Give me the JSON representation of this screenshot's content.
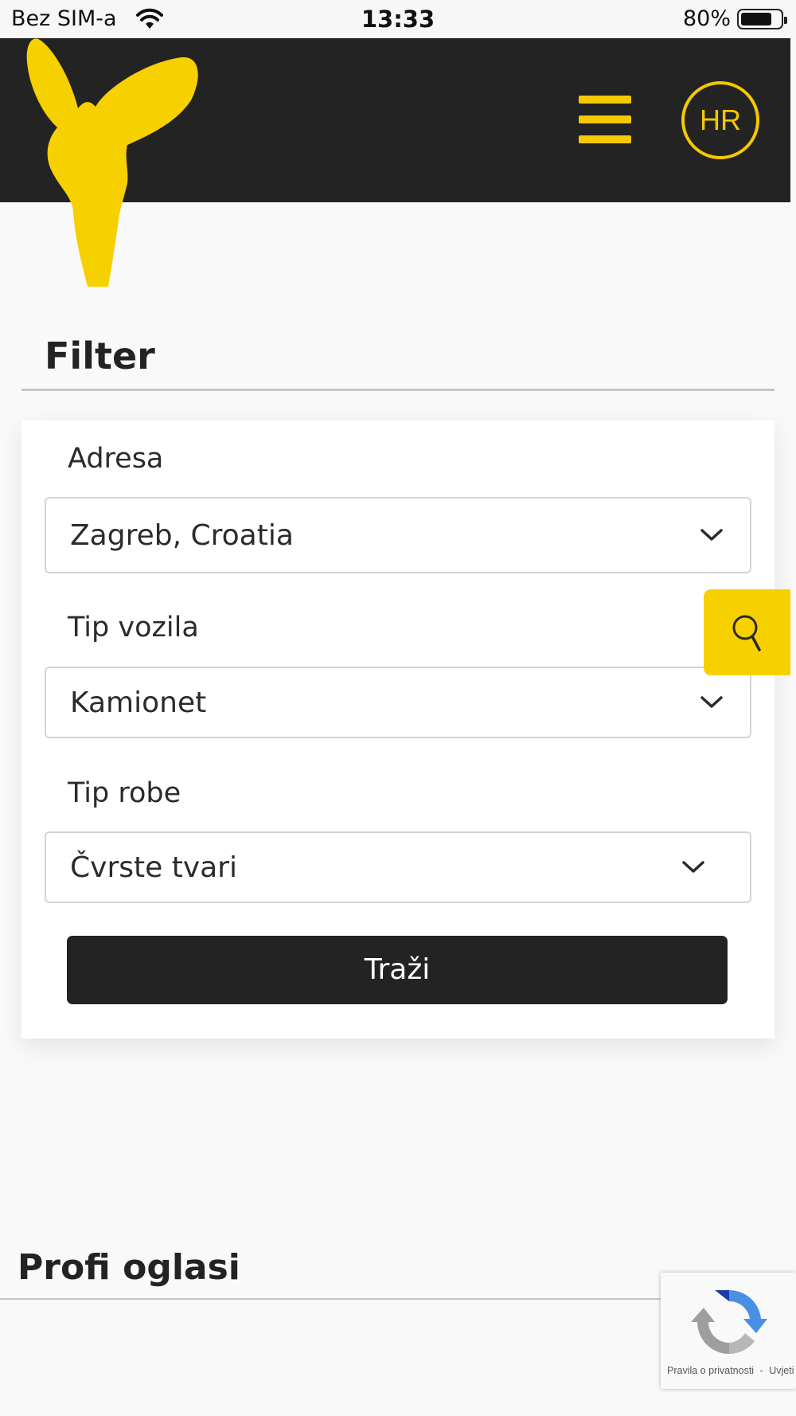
{
  "status_bar": {
    "carrier": "Bez SIM-a",
    "time": "13:33",
    "battery_percent": "80%",
    "battery_level": 0.8
  },
  "header": {
    "logo_icon": "donkey-head-logo-icon",
    "menu_icon": "hamburger-menu-icon",
    "language": "HR",
    "accent_color": "#f5c800",
    "background_color": "#232323"
  },
  "filter": {
    "title": "Filter",
    "address": {
      "label": "Adresa",
      "value": "Zagreb, Croatia"
    },
    "vehicle_type": {
      "label": "Tip vozila",
      "value": "Kamionet"
    },
    "goods_type": {
      "label": "Tip robe",
      "value": "Čvrste tvari"
    },
    "search_button": "Traži",
    "side_search_icon": "search-icon"
  },
  "profi": {
    "title": "Profi oglasi"
  },
  "recaptcha": {
    "privacy": "Pravila o privatnosti",
    "separator": "-",
    "terms": "Uvjeti"
  }
}
